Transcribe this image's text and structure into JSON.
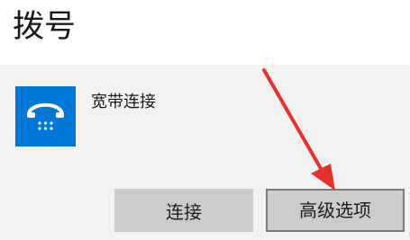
{
  "page": {
    "title": "拨号"
  },
  "connection": {
    "icon": "dial-up-phone-icon",
    "name": "宽带连接"
  },
  "buttons": {
    "connect": "连接",
    "advanced": "高级选项"
  },
  "colors": {
    "icon_bg": "#0078d7",
    "panel_bg": "#f2f2f2",
    "button_bg": "#cccccc",
    "arrow": "#e8312f"
  }
}
